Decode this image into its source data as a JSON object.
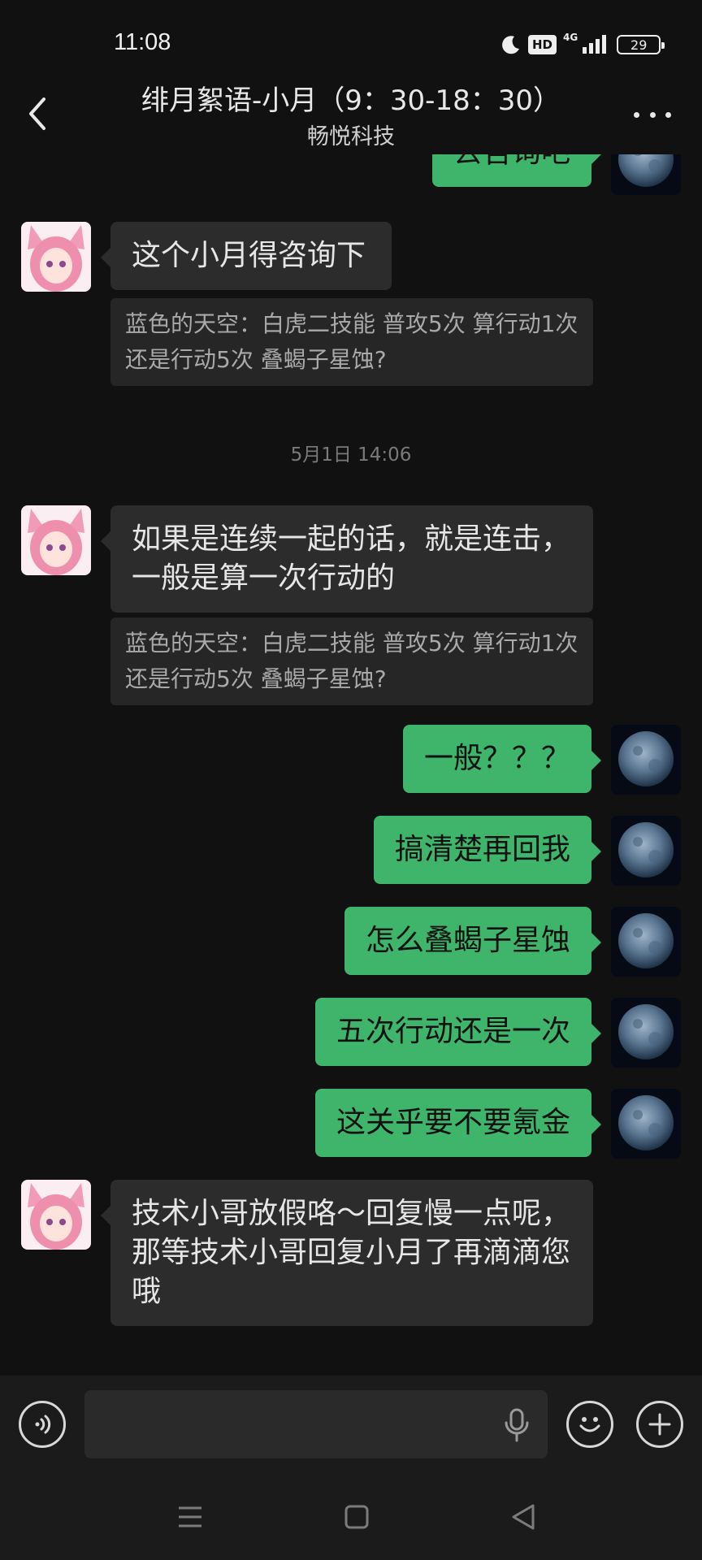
{
  "status_bar": {
    "time": "11:08",
    "hd_label": "HD",
    "network_label": "4G",
    "battery_level": "29"
  },
  "header": {
    "title": "绯月絮语-小月（9：30-18：30）",
    "subtitle": "畅悦科技",
    "back_icon": "chevron-left-icon",
    "more_icon": "more-horizontal-icon"
  },
  "messages": {
    "m0": {
      "text": "去咨询吧"
    },
    "m1": {
      "text": "这个小月得咨询下",
      "quote": "蓝色的天空：白虎二技能 普攻5次 算行动1次还是行动5次 叠蝎子星蚀?"
    },
    "timestamp": "5月1日 14:06",
    "m2": {
      "text": "如果是连续一起的话，就是连击，一般是算一次行动的",
      "quote": "蓝色的天空：白虎二技能 普攻5次 算行动1次还是行动5次 叠蝎子星蚀?"
    },
    "m3": {
      "text": "一般？？？"
    },
    "m4": {
      "text": "搞清楚再回我"
    },
    "m5": {
      "text": "怎么叠蝎子星蚀"
    },
    "m6": {
      "text": "五次行动还是一次"
    },
    "m7": {
      "text": "这关乎要不要氪金"
    },
    "m8": {
      "text": "技术小哥放假咯～回复慢一点呢，那等技术小哥回复小月了再滴滴您哦"
    }
  },
  "input_bar": {
    "voice_icon": "voice-icon",
    "mic_icon": "microphone-icon",
    "emoji_icon": "emoji-icon",
    "plus_icon": "plus-icon",
    "text_value": ""
  },
  "colors": {
    "background": "#111111",
    "outgoing_bubble": "#3eb56a",
    "incoming_bubble": "#2c2c2c",
    "quote_bg": "#262626"
  }
}
